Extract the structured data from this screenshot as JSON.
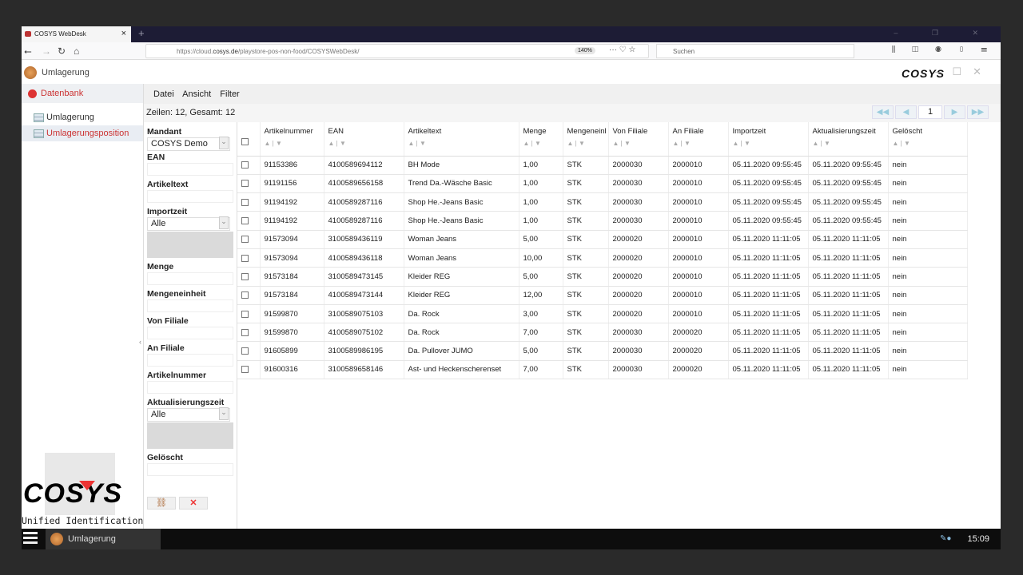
{
  "browser": {
    "tab_title": "COSYS WebDesk",
    "url_prefix": "https://cloud.",
    "url_domain": "cosys.de",
    "url_path": "/playstore-pos-non-food/COSYSWebDesk/",
    "zoom": "140%",
    "search_placeholder": "Suchen"
  },
  "app": {
    "title": "Umlagerung",
    "logo_text": "COSYS",
    "subtitle": "Unified Identification"
  },
  "sidebar": {
    "section": "Datenbank",
    "items": [
      {
        "label": "Umlagerung"
      },
      {
        "label": "Umlagerungsposition",
        "active": true
      }
    ]
  },
  "menu": {
    "items": [
      "Datei",
      "Ansicht",
      "Filter"
    ]
  },
  "summary": "Zeilen: 12, Gesamt: 12",
  "pager": {
    "page": "1"
  },
  "filter": {
    "mandant_label": "Mandant",
    "mandant_value": "COSYS Demo",
    "ean": "EAN",
    "artikeltext": "Artikeltext",
    "importzeit": "Importzeit",
    "importzeit_value": "Alle",
    "menge": "Menge",
    "mengeneinheit": "Mengeneinheit",
    "von_filiale": "Von Filiale",
    "an_filiale": "An Filiale",
    "artikelnummer": "Artikelnummer",
    "aktualisierungszeit": "Aktualisierungszeit",
    "aktualisierungszeit_value": "Alle",
    "geloescht": "Gelöscht"
  },
  "table": {
    "columns": [
      "Artikelnummer",
      "EAN",
      "Artikeltext",
      "Menge",
      "Mengeneinl",
      "Von Filiale",
      "An Filiale",
      "Importzeit",
      "Aktualisierungszeit",
      "Gelöscht"
    ],
    "rows": [
      [
        "91153386",
        "4100589694112",
        "BH Mode",
        "1,00",
        "STK",
        "2000030",
        "2000010",
        "05.11.2020 09:55:45",
        "05.11.2020 09:55:45",
        "nein"
      ],
      [
        "91191156",
        "4100589656158",
        "Trend Da.-Wäsche Basic",
        "1,00",
        "STK",
        "2000030",
        "2000010",
        "05.11.2020 09:55:45",
        "05.11.2020 09:55:45",
        "nein"
      ],
      [
        "91194192",
        "4100589287116",
        "Shop He.-Jeans Basic",
        "1,00",
        "STK",
        "2000030",
        "2000010",
        "05.11.2020 09:55:45",
        "05.11.2020 09:55:45",
        "nein"
      ],
      [
        "91194192",
        "4100589287116",
        "Shop He.-Jeans Basic",
        "1,00",
        "STK",
        "2000030",
        "2000010",
        "05.11.2020 09:55:45",
        "05.11.2020 09:55:45",
        "nein"
      ],
      [
        "91573094",
        "3100589436119",
        "Woman Jeans",
        "5,00",
        "STK",
        "2000020",
        "2000010",
        "05.11.2020 11:11:05",
        "05.11.2020 11:11:05",
        "nein"
      ],
      [
        "91573094",
        "4100589436118",
        "Woman Jeans",
        "10,00",
        "STK",
        "2000020",
        "2000010",
        "05.11.2020 11:11:05",
        "05.11.2020 11:11:05",
        "nein"
      ],
      [
        "91573184",
        "3100589473145",
        "Kleider REG",
        "5,00",
        "STK",
        "2000020",
        "2000010",
        "05.11.2020 11:11:05",
        "05.11.2020 11:11:05",
        "nein"
      ],
      [
        "91573184",
        "4100589473144",
        "Kleider REG",
        "12,00",
        "STK",
        "2000020",
        "2000010",
        "05.11.2020 11:11:05",
        "05.11.2020 11:11:05",
        "nein"
      ],
      [
        "91599870",
        "3100589075103",
        "Da. Rock",
        "3,00",
        "STK",
        "2000020",
        "2000010",
        "05.11.2020 11:11:05",
        "05.11.2020 11:11:05",
        "nein"
      ],
      [
        "91599870",
        "4100589075102",
        "Da. Rock",
        "7,00",
        "STK",
        "2000030",
        "2000020",
        "05.11.2020 11:11:05",
        "05.11.2020 11:11:05",
        "nein"
      ],
      [
        "91605899",
        "3100589986195",
        "Da. Pullover JUMO",
        "5,00",
        "STK",
        "2000030",
        "2000020",
        "05.11.2020 11:11:05",
        "05.11.2020 11:11:05",
        "nein"
      ],
      [
        "91600316",
        "3100589658146",
        "Ast- und Heckenscherenset",
        "7,00",
        "STK",
        "2000030",
        "2000020",
        "05.11.2020 11:11:05",
        "05.11.2020 11:11:05",
        "nein"
      ]
    ]
  },
  "taskbar": {
    "task": "Umlagerung",
    "clock": "15:09"
  },
  "colors": {
    "accent": "#cc3333",
    "tabbar": "#1d1c35"
  }
}
